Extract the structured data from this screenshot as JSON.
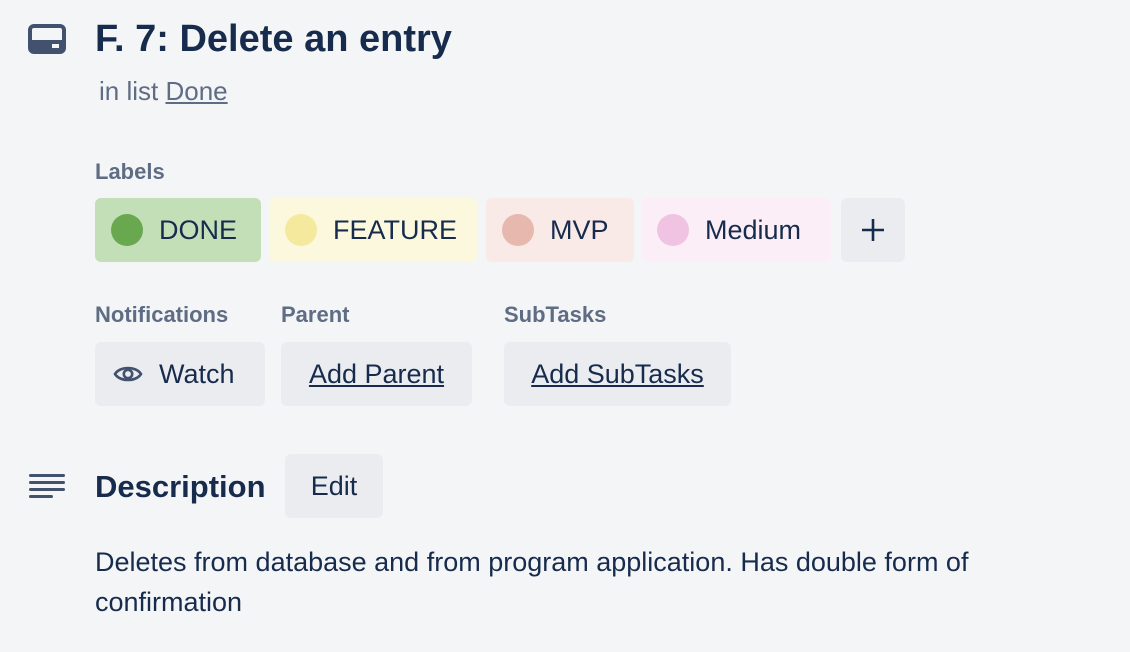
{
  "card": {
    "title": "F. 7: Delete an entry",
    "in_list_prefix": "in list",
    "list_name": "Done"
  },
  "labels_section": {
    "heading": "Labels",
    "labels": [
      {
        "text": "DONE",
        "bg": "#c3dfb8",
        "dot": "#6aa84f"
      },
      {
        "text": "FEATURE",
        "bg": "#fbf8dd",
        "dot": "#f5e99e"
      },
      {
        "text": "MVP",
        "bg": "#f9e9e7",
        "dot": "#e6b8ae"
      },
      {
        "text": "Medium",
        "bg": "#fbeef6",
        "dot": "#f0c3e3"
      }
    ],
    "add_icon": "plus-icon"
  },
  "notifications": {
    "heading": "Notifications",
    "watch_label": "Watch",
    "icon": "eye-icon"
  },
  "parent": {
    "heading": "Parent",
    "button_label": "Add Parent"
  },
  "subtasks": {
    "heading": "SubTasks",
    "button_label": "Add SubTasks"
  },
  "description": {
    "heading": "Description",
    "edit_label": "Edit",
    "icon": "description-lines-icon",
    "body": "Deletes from database and from program application. Has double form of confirmation"
  }
}
